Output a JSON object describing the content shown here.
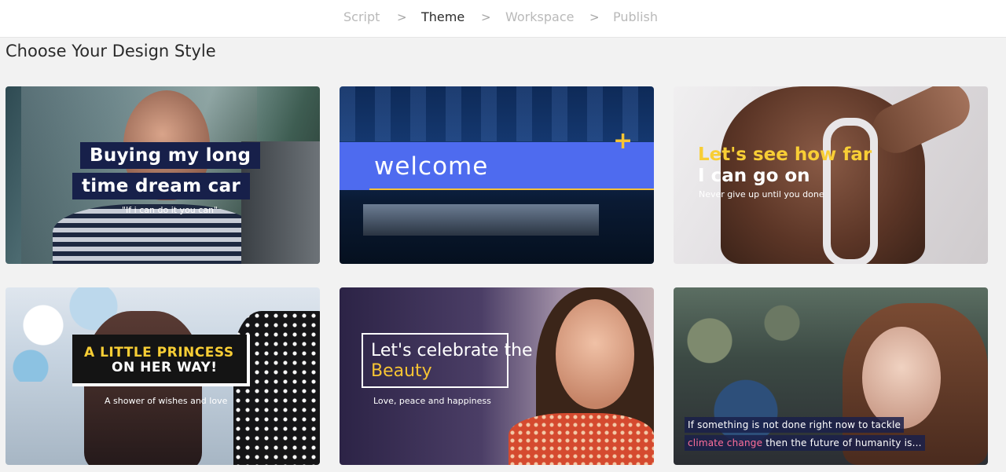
{
  "stepper": {
    "steps": [
      "Script",
      "Theme",
      "Workspace",
      "Publish"
    ],
    "active": "Theme",
    "separator": ">"
  },
  "page_title": "Choose Your Design Style",
  "themes": [
    {
      "title_line1": "Buying my long",
      "title_line2": "time dream car",
      "subtitle": "\"If i can do it you can\""
    },
    {
      "title": "welcome",
      "plus": "+"
    },
    {
      "title_line1": "Let's see how far",
      "title_line2": "I can go on",
      "subtitle": "Never give up until you done"
    },
    {
      "title_line1": "A LITTLE PRINCESS",
      "title_line2": "ON HER WAY!",
      "subtitle": "A shower of wishes and love"
    },
    {
      "title_line1": "Let's celebrate the",
      "title_line2": "Beauty",
      "subtitle": "Love, peace and happiness"
    },
    {
      "line1": "If something is not done right now to tackle",
      "line2_highlight": "climate change",
      "line2_rest": " then the future of humanity is..."
    }
  ],
  "colors": {
    "accent_yellow": "#f6c433",
    "navy": "#17204a",
    "welcome_blue": "#4e6bef",
    "highlight_pink": "#ff6f9a"
  }
}
